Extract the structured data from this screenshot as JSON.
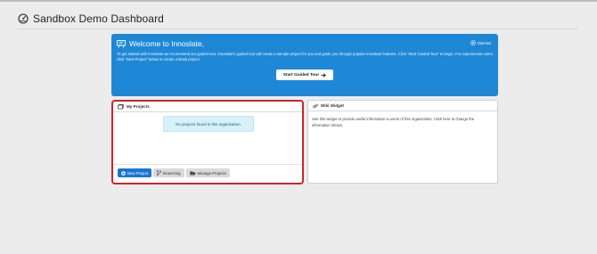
{
  "header": {
    "title": "Sandbox Demo Dashboard",
    "icon": "dashboard-gauge-icon"
  },
  "welcome": {
    "title": "Welcome to Innoslate,",
    "dismiss_label": "Dismiss",
    "body": "To get started with Innoslate we recommend our guided tour. Innoslate's guided tour will create a sample project for you and guide you through popular Innoslate features. Click \"Start Guided Tour\" to begin. For experienced users, click \"New Project\" below to create a blank project.",
    "tour_button": "Start Guided Tour",
    "bg_color": "#1e88d6"
  },
  "projects": {
    "title": "My Projects",
    "empty_message": "No projects found in this organization.",
    "buttons": {
      "new_project": "New Project",
      "branching": "Branching",
      "manage_projects": "Manage Projects"
    },
    "highlight_color": "#d0242e"
  },
  "wiki": {
    "title": "Wiki Widget",
    "text": "Use this widget to provide useful information to users of this organization. Click here to change the information shown."
  }
}
